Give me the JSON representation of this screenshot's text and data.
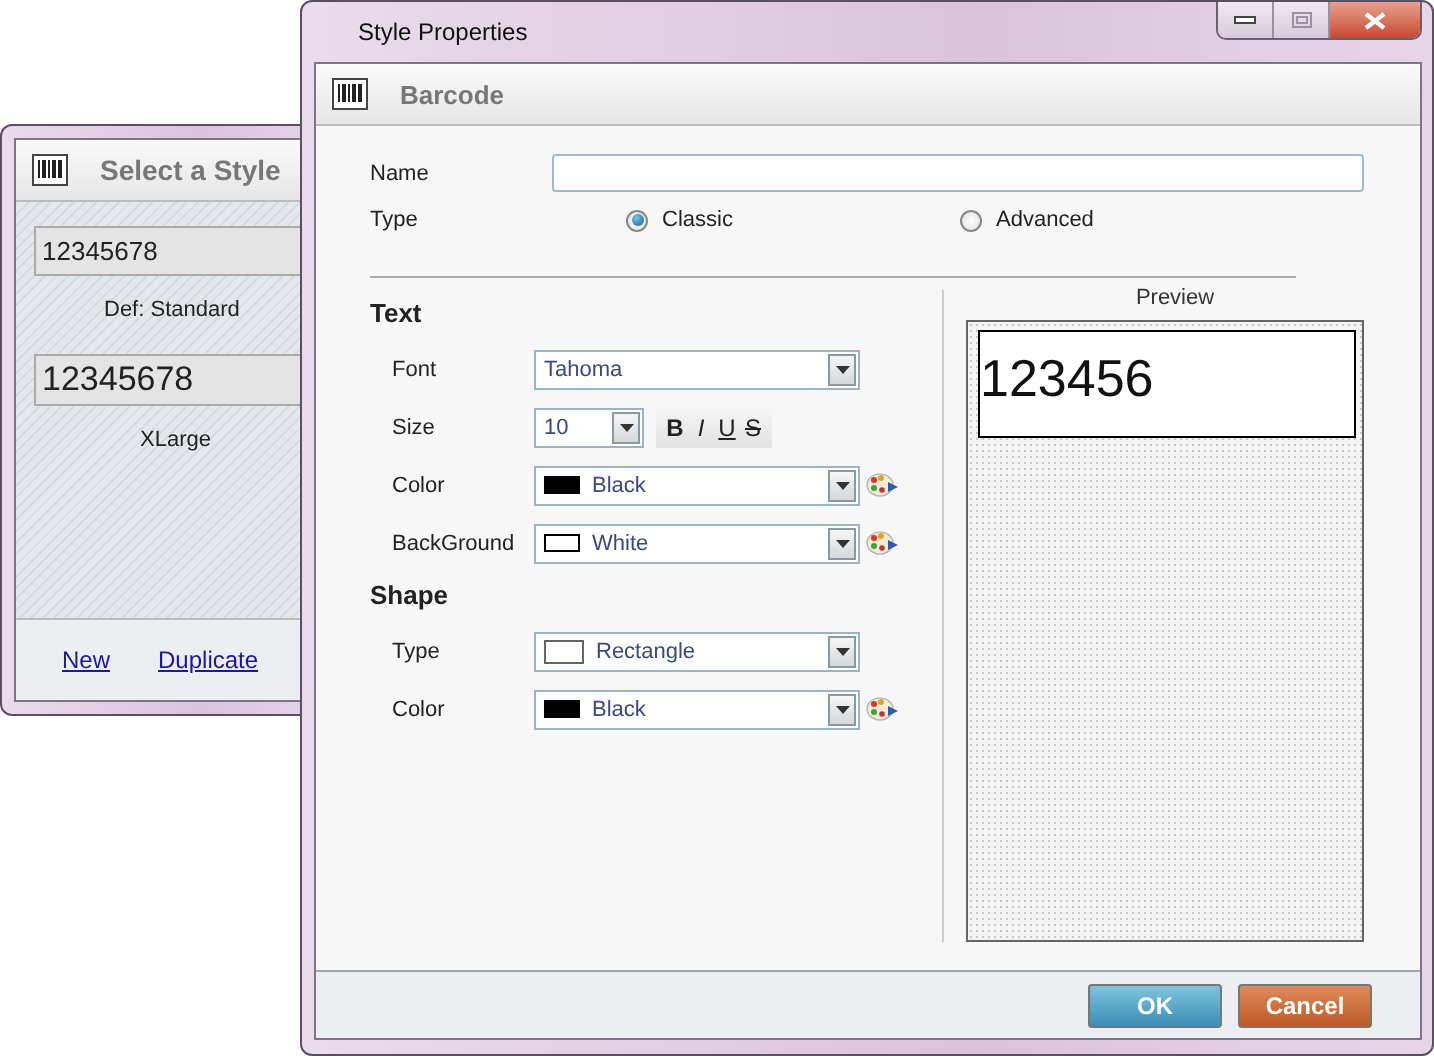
{
  "select_window": {
    "title": "Select a Style",
    "styles": [
      {
        "kind": "standard",
        "sample": "12345678",
        "name": "Def: Standard"
      },
      {
        "kind": "xlarge",
        "sample": "12345678",
        "name": "XLarge"
      }
    ],
    "links": [
      "New",
      "Duplicate"
    ]
  },
  "properties_window": {
    "title": "Style Properties",
    "header": "Barcode",
    "name_field": {
      "label": "Name"
    },
    "type_field": {
      "label": "Type",
      "options": [
        {
          "label": "Classic",
          "selected": true
        },
        {
          "label": "Advanced",
          "selected": false
        }
      ]
    },
    "sections": [
      {
        "title": "Text",
        "rows": [
          {
            "kind": "combo",
            "label": "Font",
            "value": "Tahoma"
          },
          {
            "kind": "size",
            "label": "Size",
            "value": "10",
            "format_buttons": [
              {
                "kind": "bold",
                "label": "B"
              },
              {
                "kind": "italic",
                "label": "I"
              },
              {
                "kind": "underline",
                "label": "U"
              },
              {
                "kind": "strike",
                "label": "S"
              }
            ]
          },
          {
            "kind": "color",
            "label": "Color",
            "value": "Black",
            "color": "#000000"
          },
          {
            "kind": "color",
            "label": "BackGround",
            "value": "White",
            "color": "#ffffff"
          }
        ]
      },
      {
        "title": "Shape",
        "rows": [
          {
            "kind": "shape",
            "label": "Type",
            "value": "Rectangle"
          },
          {
            "kind": "color",
            "label": "Color",
            "value": "Black",
            "color": "#000000"
          }
        ]
      }
    ],
    "preview": {
      "label": "Preview",
      "sample": "123456"
    },
    "buttons": [
      {
        "kind": "primary",
        "label": "OK"
      },
      {
        "kind": "danger",
        "label": "Cancel"
      }
    ]
  }
}
